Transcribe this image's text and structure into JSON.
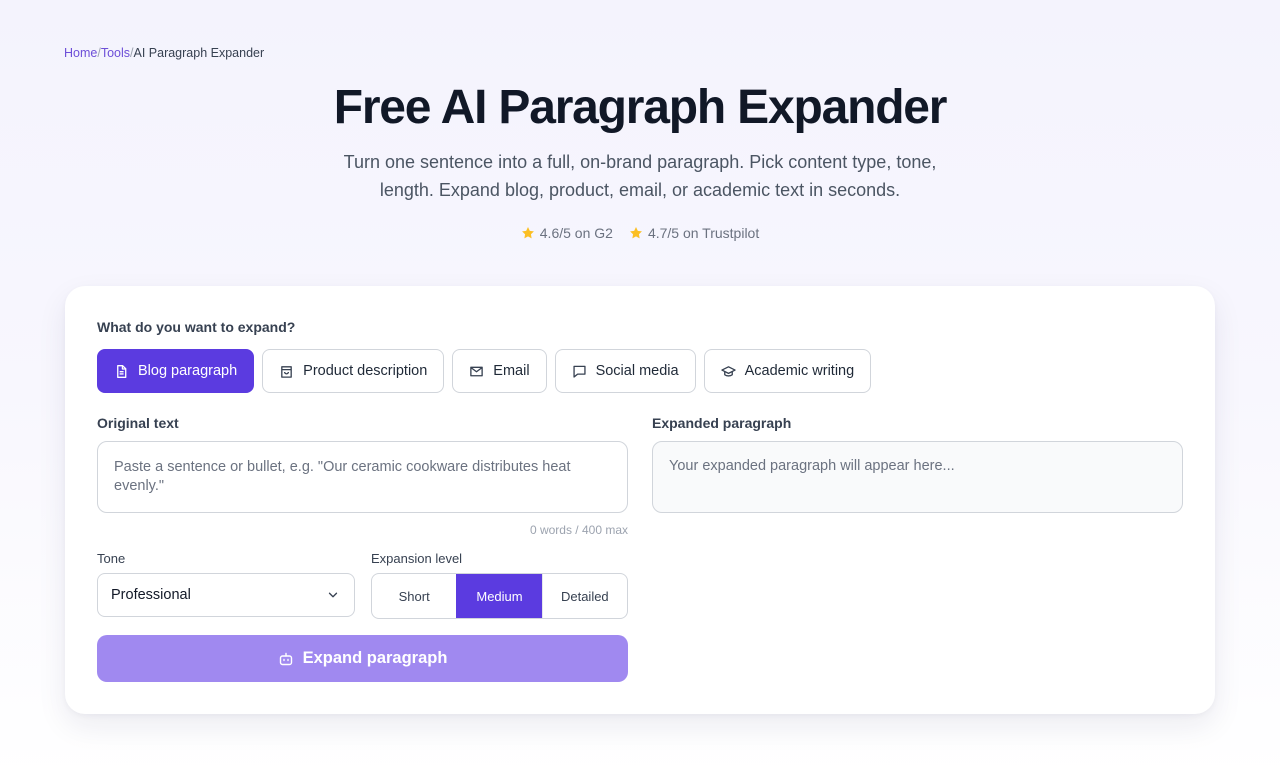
{
  "breadcrumb": {
    "home": "Home",
    "tools": "Tools",
    "current": "AI Paragraph Expander",
    "separator": "/"
  },
  "hero": {
    "title": "Free AI Paragraph Expander",
    "subtitle": "Turn one sentence into a full, on-brand paragraph. Pick content type, tone, length. Expand blog, product, email, or academic text in seconds."
  },
  "ratings": [
    {
      "text": "4.6/5 on G2",
      "icon": "star-icon"
    },
    {
      "text": "4.7/5 on Trustpilot",
      "icon": "star-icon"
    }
  ],
  "form": {
    "content_type_label": "What do you want to expand?",
    "content_types": [
      {
        "label": "Blog paragraph",
        "icon": "document-icon",
        "active": true
      },
      {
        "label": "Product description",
        "icon": "shopping-bag-icon",
        "active": false
      },
      {
        "label": "Email",
        "icon": "mail-icon",
        "active": false
      },
      {
        "label": "Social media",
        "icon": "chat-bubble-icon",
        "active": false
      },
      {
        "label": "Academic writing",
        "icon": "graduation-cap-icon",
        "active": false
      }
    ],
    "original_label": "Original text",
    "original_placeholder": "Paste a sentence or bullet, e.g. \"Our ceramic cookware distributes heat evenly.\"",
    "word_count": "0 words / 400 max",
    "expanded_label": "Expanded paragraph",
    "expanded_placeholder": "Your expanded paragraph will appear here...",
    "tone_label": "Tone",
    "tone_value": "Professional",
    "expansion_label": "Expansion level",
    "expansion_options": [
      "Short",
      "Medium",
      "Detailed"
    ],
    "expansion_selected": "Medium",
    "submit_label": "Expand paragraph"
  },
  "colors": {
    "accent": "#5b3be0",
    "button_disabled": "#a089f0",
    "link": "#6d4fd8",
    "star": "#fbbf24"
  }
}
